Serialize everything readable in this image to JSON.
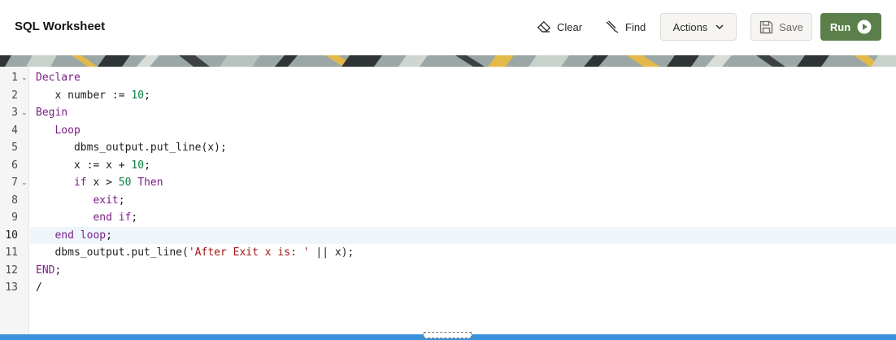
{
  "header": {
    "title": "SQL Worksheet",
    "clear_label": "Clear",
    "find_label": "Find",
    "actions_label": "Actions",
    "save_label": "Save",
    "run_label": "Run",
    "run_color": "#5b7f4a"
  },
  "editor": {
    "active_line": 10,
    "lines": [
      {
        "no": "1",
        "fold": true,
        "tokens": [
          {
            "t": "Declare",
            "k": "kw"
          }
        ]
      },
      {
        "no": "2",
        "fold": false,
        "tokens": [
          {
            "t": "   x number := "
          },
          {
            "t": "10",
            "k": "num"
          },
          {
            "t": ";"
          }
        ]
      },
      {
        "no": "3",
        "fold": true,
        "tokens": [
          {
            "t": "Begin",
            "k": "kw"
          }
        ]
      },
      {
        "no": "4",
        "fold": false,
        "tokens": [
          {
            "t": "   "
          },
          {
            "t": "Loop",
            "k": "kw"
          }
        ]
      },
      {
        "no": "5",
        "fold": false,
        "tokens": [
          {
            "t": "      dbms_output.put_line(x);"
          }
        ]
      },
      {
        "no": "6",
        "fold": false,
        "tokens": [
          {
            "t": "      x := x + "
          },
          {
            "t": "10",
            "k": "num"
          },
          {
            "t": ";"
          }
        ]
      },
      {
        "no": "7",
        "fold": true,
        "tokens": [
          {
            "t": "      "
          },
          {
            "t": "if",
            "k": "kw"
          },
          {
            "t": " x > "
          },
          {
            "t": "50",
            "k": "num"
          },
          {
            "t": " "
          },
          {
            "t": "Then",
            "k": "kw"
          }
        ]
      },
      {
        "no": "8",
        "fold": false,
        "tokens": [
          {
            "t": "         "
          },
          {
            "t": "exit",
            "k": "kw"
          },
          {
            "t": ";"
          }
        ]
      },
      {
        "no": "9",
        "fold": false,
        "tokens": [
          {
            "t": "         "
          },
          {
            "t": "end if",
            "k": "kw"
          },
          {
            "t": ";"
          }
        ]
      },
      {
        "no": "10",
        "fold": false,
        "tokens": [
          {
            "t": "   "
          },
          {
            "t": "end loop",
            "k": "kw"
          },
          {
            "t": ";"
          }
        ]
      },
      {
        "no": "11",
        "fold": false,
        "tokens": [
          {
            "t": "   dbms_output.put_line("
          },
          {
            "t": "'After Exit x is: '",
            "k": "str"
          },
          {
            "t": " || x);"
          }
        ]
      },
      {
        "no": "12",
        "fold": false,
        "tokens": [
          {
            "t": "END",
            "k": "kw"
          },
          {
            "t": ";"
          }
        ]
      },
      {
        "no": "13",
        "fold": false,
        "tokens": [
          {
            "t": "/"
          }
        ]
      }
    ]
  },
  "icons": {
    "clear": "eraser-icon",
    "find": "find-icon",
    "actions": "chevron-down-icon",
    "save": "save-icon",
    "run": "play-icon"
  }
}
